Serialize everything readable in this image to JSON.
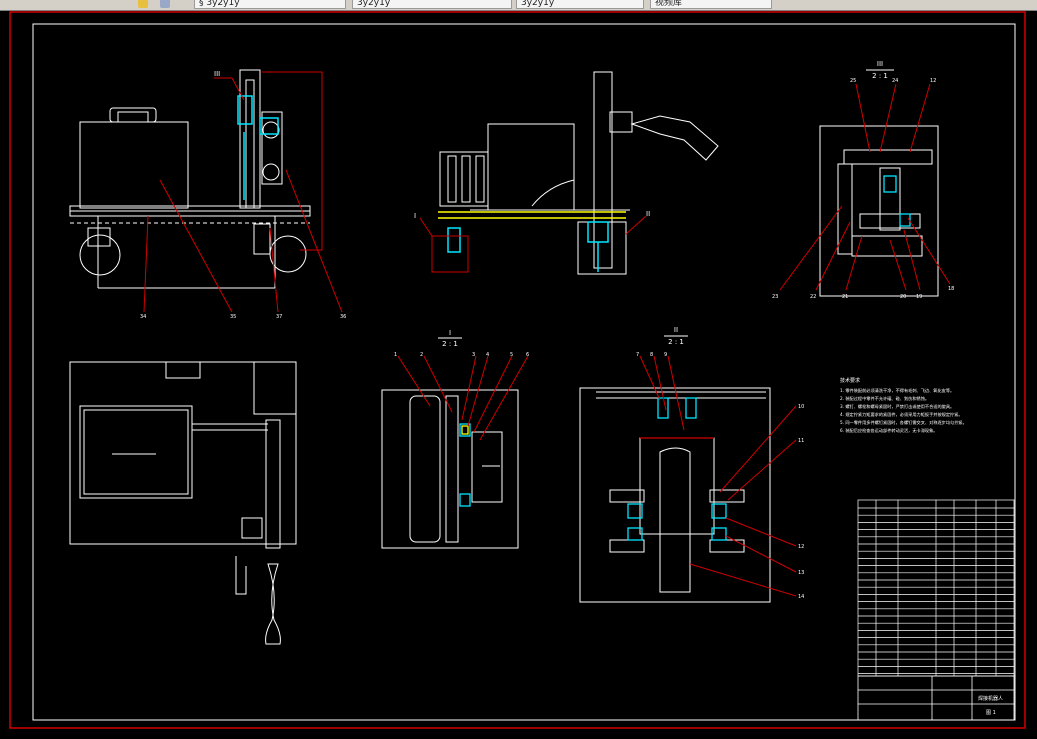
{
  "tabs": [
    {
      "label": "§ 3у2у1у"
    },
    {
      "label": "3у2у1у"
    },
    {
      "label": "3у2у1у"
    },
    {
      "label": "视频库"
    }
  ],
  "drawing": {
    "views": {
      "detail_III": {
        "label": "III",
        "scale": "2 : 1"
      },
      "detail_I": {
        "label": "I",
        "scale": "2 : 1"
      },
      "detail_II": {
        "label": "II",
        "scale": "2 : 1"
      }
    },
    "callouts_front": [
      "34",
      "35",
      "37",
      "36"
    ],
    "callouts_side": [
      "I",
      "II"
    ],
    "callouts_III": [
      "25",
      "24",
      "12",
      "23",
      "22",
      "21",
      "20",
      "19",
      "18"
    ],
    "callouts_I": [
      "1",
      "2",
      "3",
      "4",
      "5",
      "6"
    ],
    "callouts_II": [
      "7",
      "8",
      "9",
      "10",
      "11",
      "12",
      "13",
      "14"
    ],
    "tech_notes_title": "技术要求",
    "tech_notes": [
      "1. 零件装配前必须清洗干净，不得有毛刺、飞边、氧化皮等。",
      "2. 装配过程中零件不允许磕、碰、划伤和锈蚀。",
      "3. 螺钉、螺栓和螺母紧固时，严禁打击或使用不合适的旋具。",
      "4. 规定拧紧力矩要求的紧固件，必须采用力矩扳手并按规定拧紧。",
      "5. 同一零件用多件螺钉紧固时，各螺钉需交叉、对称逐步均匀拧紧。",
      "6. 装配后应检查各运动部件转动灵活，无卡滞现象。"
    ],
    "title_block": {
      "name": "焊接机器人",
      "sheet": "图 1"
    }
  },
  "colors": {
    "frame": "#d00000",
    "line": "#ffffff",
    "highlight": "#00e5ff",
    "yellow": "#ffff00"
  }
}
